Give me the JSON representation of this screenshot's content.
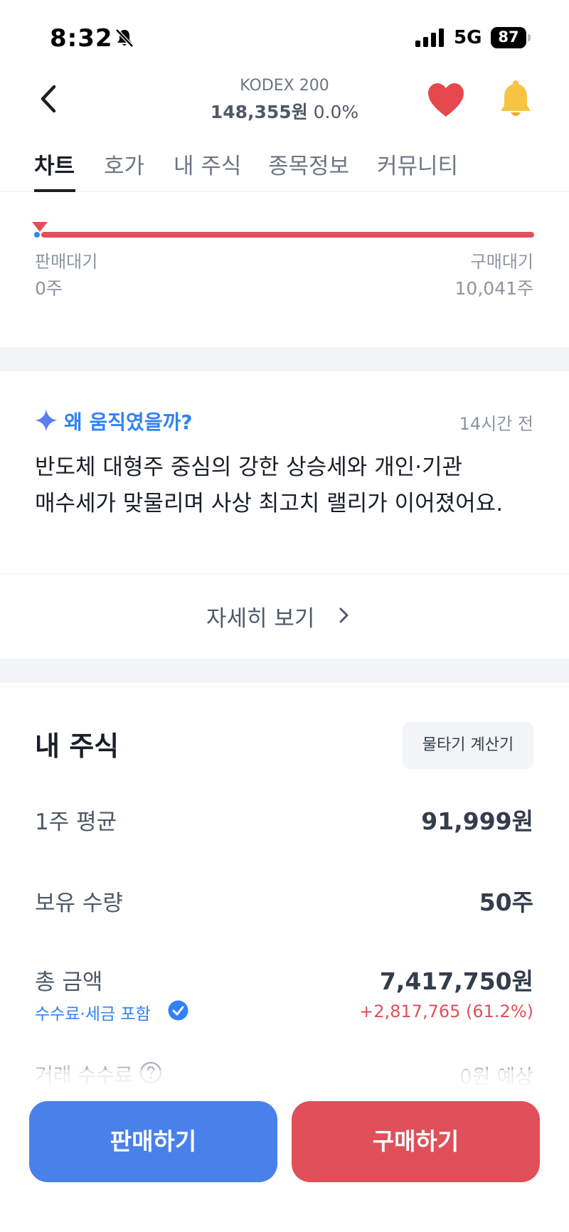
{
  "status_bar": {
    "time": "8:32",
    "network": "5G",
    "battery": "87",
    "mute_icon": "bell-slash-icon",
    "signal_icon": "signal-bars-icon"
  },
  "header": {
    "back_icon": "chevron-left-icon",
    "title": "KODEX 200",
    "price": "148,355원",
    "change": "0.0%",
    "favorite_icon": "heart-icon",
    "alert_icon": "bell-icon",
    "favorite_color": "#e5484d",
    "alert_color": "#f6c343"
  },
  "tabs": [
    {
      "label": "차트",
      "active": true
    },
    {
      "label": "호가",
      "active": false
    },
    {
      "label": "내 주식",
      "active": false
    },
    {
      "label": "종목정보",
      "active": false
    },
    {
      "label": "커뮤니티",
      "active": false
    }
  ],
  "order_balance": {
    "sell_label": "판매대기",
    "sell_value": "0주",
    "buy_label": "구매대기",
    "buy_value": "10,041주",
    "buy_ratio": 1.0
  },
  "why_moved": {
    "icon": "sparkle-icon",
    "title": "왜 움직였을까?",
    "time": "14시간 전",
    "body_line1": "반도체 대형주 중심의 강한 상승세와 개인·기관",
    "body_line2": "매수세가 맞물리며 사상 최고치 랠리가 이어졌어요.",
    "more_label": "자세히 보기",
    "more_icon": "chevron-right-icon"
  },
  "my_stock": {
    "title": "내 주식",
    "calculator_label": "물타기 계산기",
    "avg_label": "1주 평균",
    "avg_value": "91,999원",
    "qty_label": "보유 수량",
    "qty_value": "50주",
    "total_label": "총 금액",
    "total_value": "7,417,750원",
    "fee_note": "수수료·세금 포함",
    "fee_note_icon": "check-circle-icon",
    "profit": "+2,817,765 (61.2%)",
    "trade_fee_label": "거래 수수료",
    "trade_fee_icon": "question-circle-icon",
    "trade_fee_value": "0원 예상"
  },
  "actions": {
    "sell_label": "판매하기",
    "buy_label": "구매하기"
  },
  "colors": {
    "accent_blue": "#3182f6",
    "sell_blue": "#4a80ea",
    "buy_red": "#e0505a",
    "text_primary": "#191f28"
  }
}
